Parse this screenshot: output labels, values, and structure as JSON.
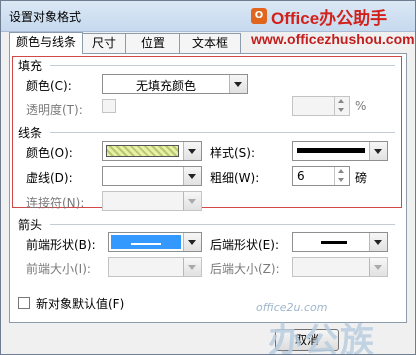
{
  "window": {
    "title": "设置对象格式"
  },
  "brand": {
    "logo_glyph": "O",
    "name": "Office办公助手",
    "url": "www.officezhushou.com"
  },
  "tabs": [
    {
      "label": "颜色与线条",
      "active": true
    },
    {
      "label": "尺寸",
      "active": false
    },
    {
      "label": "位置",
      "active": false
    },
    {
      "label": "文本框",
      "active": false
    }
  ],
  "fill": {
    "section_label": "填充",
    "color_label": "颜色(C):",
    "color_value": "无填充颜色",
    "transparency_label": "透明度(T):",
    "transparency_unit": "%"
  },
  "line": {
    "section_label": "线条",
    "color_label": "颜色(O):",
    "dash_label": "虚线(D):",
    "connector_label": "连接符(N):",
    "style_label": "样式(S):",
    "weight_label": "粗细(W):",
    "weight_value": "6",
    "weight_unit": "磅"
  },
  "arrows": {
    "section_label": "箭头",
    "begin_style_label": "前端形状(B):",
    "begin_size_label": "前端大小(I):",
    "end_style_label": "后端形状(E):",
    "end_size_label": "后端大小(Z):"
  },
  "default_checkbox": {
    "label": "新对象默认值(F)",
    "checked": false
  },
  "buttons": {
    "cancel_label": "取消"
  },
  "watermark": {
    "url": "office2u.com",
    "text": "办公族"
  },
  "colors": {
    "accent_red": "#d14848",
    "selected_blue": "#3399ff",
    "brand_red": "#d2201b"
  }
}
